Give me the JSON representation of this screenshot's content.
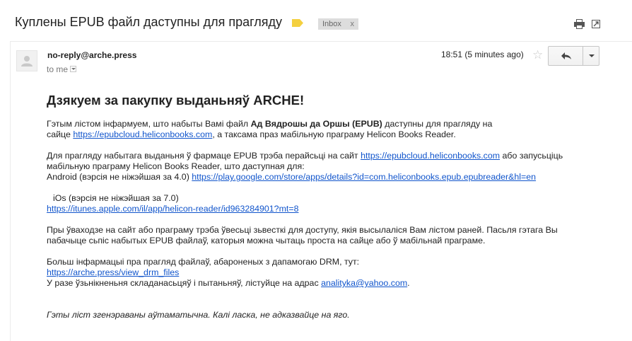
{
  "subject": "Куплены EPUB файл даступны для прагляду",
  "label_chip": {
    "text": "Inbox",
    "close": "x"
  },
  "colors": {
    "label_tag": "#f4d03f",
    "link": "#1155cc"
  },
  "icons": {
    "print": "print-icon",
    "popout": "popout-icon",
    "reply": "reply-icon",
    "star": "star-icon"
  },
  "header": {
    "sender": "no-reply@arche.press",
    "to": "to me",
    "timestamp": "18:51 (5 minutes ago)"
  },
  "message": {
    "heading": "Дзякуем за пакупку выданьняў ARCHE!",
    "p1_a": "Гэтым лістом інфармуем, што набыты Вамі файл ",
    "p1_bold": "Ад Вядрошы да Оршы (EPUB)",
    "p1_b": " даступны для прагляду на",
    "p1_c": "сайце ",
    "p1_link": "https://epubcloud.heliconbooks.com",
    "p1_d": ", а таксама праз мабільную праграму Helicon Books Reader.",
    "p2_a": "Для прагляду набытага выданьня ў фармаце EPUB трэба перайсьці на сайт ",
    "p2_link": "https://epubcloud.heliconbooks.com",
    "p2_b": " або запусьціць",
    "p2_c": "мабільную праграму Helicon Books Reader, што даступная для:",
    "p2_d": "Android (вэрсія не ніжэйшая за 4.0) ",
    "p2_android_link": "https://play.google.com/store/apps/details?id=com.heliconbooks.epub.epubreader&hl=en",
    "p3_a": "iOs (вэрсія не ніжэйшая за 7.0)",
    "p3_link": "https://itunes.apple.com/il/app/helicon-reader/id963284901?mt=8",
    "p4_a": "Пры ўваходзе на сайт або праграму трэба ўвесьці зьвесткі для доступу, якія высылаліся Вам лістом раней.  Пасьля гэтага Вы",
    "p4_b": "пабачыце сьпіс набытых EPUB файлаў, каторыя можна чытаць проста на сайце або ў мабільнай праграме.",
    "p5_a": "Больш інфармацыі пра прагляд файлаў, абароненых з дапамогаю DRM, тут:",
    "p5_link": "https://arche.press/view_drm_files",
    "p5_b": "У разе ўзьнікненьня складанасьцяў і пытаньняў, лістуйце на адрас ",
    "p5_email": "analityka@yahoo.com",
    "p5_c": ".",
    "footer": "Гэты ліст згенэраваны аўтаматычна. Калі ласка, не адказвайце на яго."
  }
}
